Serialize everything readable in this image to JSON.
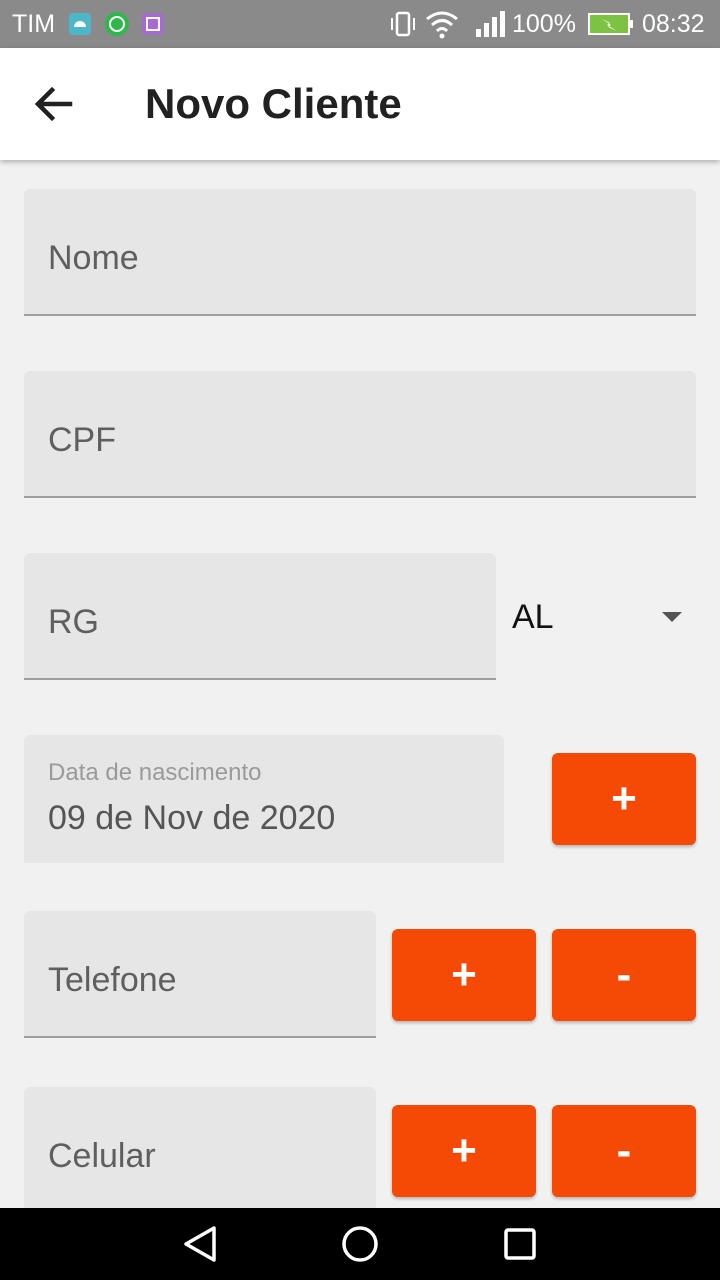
{
  "status_bar": {
    "carrier": "TIM",
    "notification_icons": [
      "android-app-icon",
      "whatsapp-icon",
      "gallery-icon"
    ],
    "system_icons": [
      "vibrate-icon",
      "wifi-icon",
      "signal-icon"
    ],
    "battery": "100%",
    "time": "08:32"
  },
  "app_bar": {
    "title": "Novo Cliente",
    "back_icon": "arrow-back-icon"
  },
  "form": {
    "nome_placeholder": "Nome",
    "cpf_placeholder": "CPF",
    "rg_placeholder": "RG",
    "uf_selected": "AL",
    "birth_label": "Data de nascimento",
    "birth_value": "09 de Nov de 2020",
    "birth_add_label": "+",
    "telefone_placeholder": "Telefone",
    "telefone_add_label": "+",
    "telefone_remove_label": "-",
    "celular_placeholder": "Celular",
    "celular_add_label": "+",
    "celular_remove_label": "-"
  },
  "colors": {
    "accent": "#f44a06",
    "field_bg": "#e6e6e6",
    "status_bar": "#8a8a8a"
  },
  "nav_bar": {
    "icons": [
      "back-triangle-icon",
      "home-circle-icon",
      "recents-square-icon"
    ]
  }
}
